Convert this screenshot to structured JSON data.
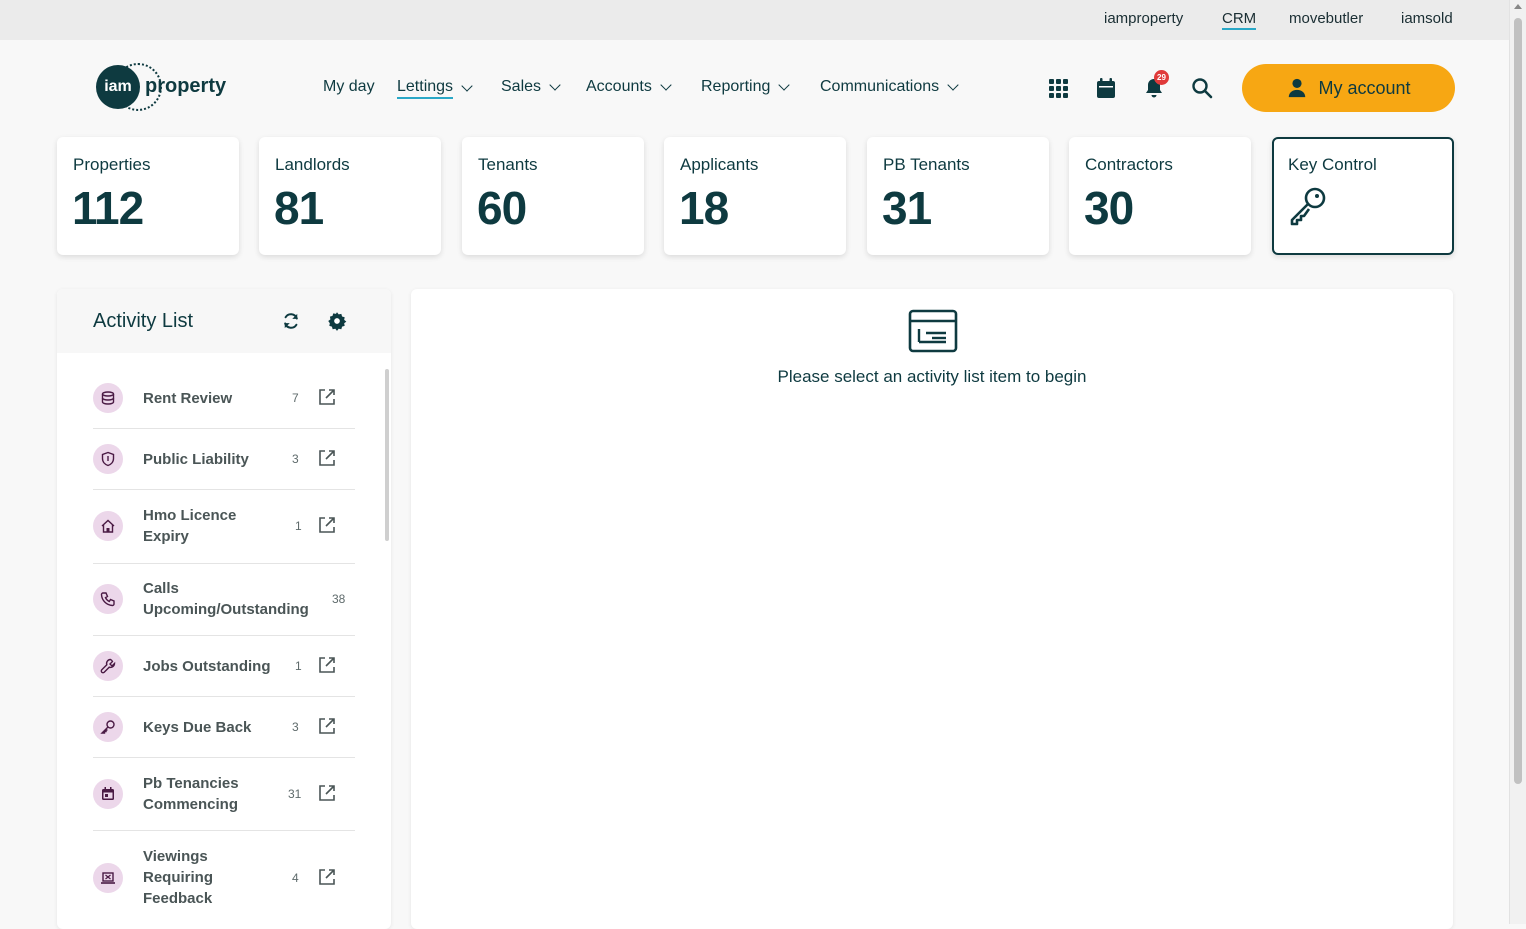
{
  "topbar": {
    "links": [
      "iamproperty",
      "CRM",
      "movebutler",
      "iamsold"
    ],
    "active": "CRM",
    "accent_color": "#2aa8c7"
  },
  "logo": {
    "circle_text": "iam",
    "word": "property"
  },
  "nav": {
    "items": [
      {
        "label": "My day",
        "has_dropdown": false
      },
      {
        "label": "Lettings",
        "has_dropdown": true,
        "active": true
      },
      {
        "label": "Sales",
        "has_dropdown": true
      },
      {
        "label": "Accounts",
        "has_dropdown": true
      },
      {
        "label": "Reporting",
        "has_dropdown": true
      },
      {
        "label": "Communications",
        "has_dropdown": true
      }
    ]
  },
  "header_icons": [
    "apps-grid-icon",
    "calendar-icon",
    "bell-icon",
    "search-icon"
  ],
  "notifications": {
    "count": "29"
  },
  "account": {
    "label": "My account",
    "color": "#f7a713"
  },
  "stats": [
    {
      "label": "Properties",
      "value": "112"
    },
    {
      "label": "Landlords",
      "value": "81"
    },
    {
      "label": "Tenants",
      "value": "60"
    },
    {
      "label": "Applicants",
      "value": "18"
    },
    {
      "label": "PB Tenants",
      "value": "31"
    },
    {
      "label": "Contractors",
      "value": "30"
    },
    {
      "label": "Key Control",
      "icon": "key-icon"
    }
  ],
  "activity": {
    "title": "Activity List",
    "items": [
      {
        "name": "Rent Review",
        "count": "7",
        "icon": "coins-icon"
      },
      {
        "name": "Public Liability",
        "count": "3",
        "icon": "shield-icon"
      },
      {
        "name": "Hmo Licence Expiry",
        "count": "1",
        "icon": "house-icon"
      },
      {
        "name": "Calls Upcoming/Outstanding",
        "count": "38",
        "icon": "phone-icon"
      },
      {
        "name": "Jobs Outstanding",
        "count": "1",
        "icon": "wrench-icon"
      },
      {
        "name": "Keys Due Back",
        "count": "3",
        "icon": "key-icon"
      },
      {
        "name": "Pb Tenancies Commencing",
        "count": "31",
        "icon": "calendar-icon"
      },
      {
        "name": "Viewings Requiring Feedback",
        "count": "4",
        "icon": "laptop-icon"
      }
    ]
  },
  "content": {
    "message": "Please select an activity list item to begin"
  },
  "colors": {
    "primary": "#0e3a40",
    "icon_bg": "#ecd7ea",
    "icon_fg": "#4a1a44"
  }
}
